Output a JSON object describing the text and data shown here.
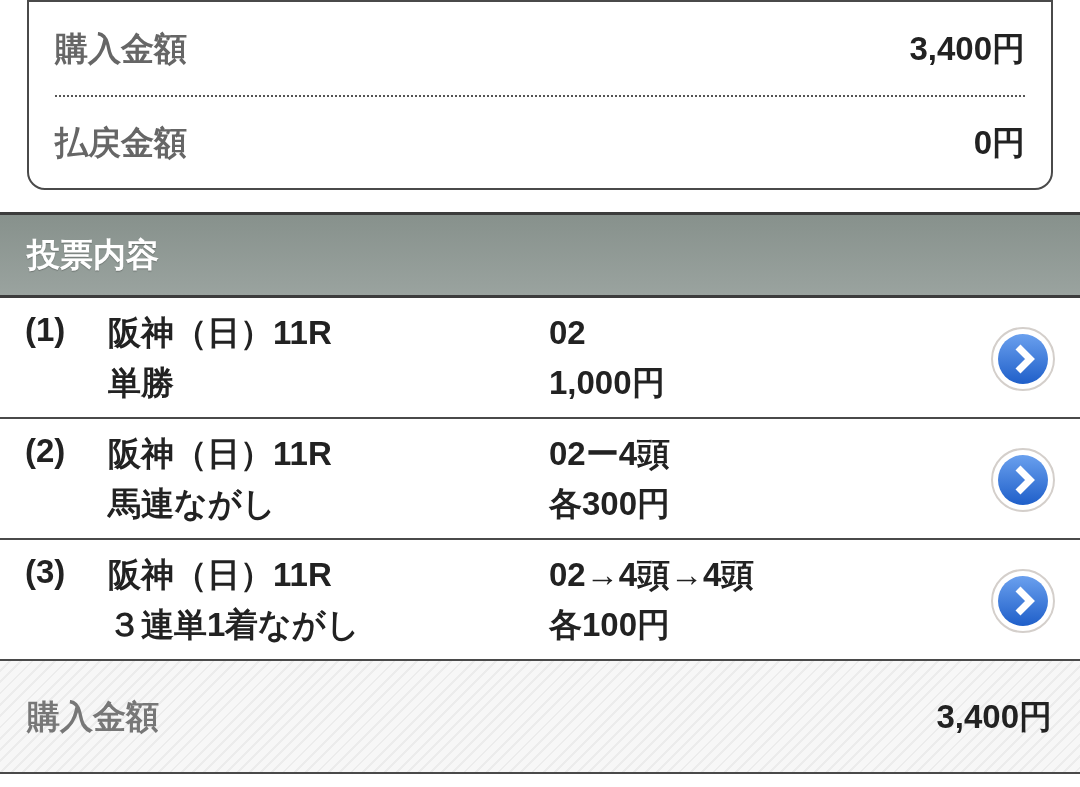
{
  "summary": {
    "rows": [
      {
        "label": "購入金額",
        "value": "3,400円"
      },
      {
        "label": "払戻金額",
        "value": "0円"
      }
    ]
  },
  "section": {
    "title": "投票内容"
  },
  "bets": [
    {
      "number": "(1)",
      "race": "阪神（日）11R",
      "type": "単勝",
      "selection": "02",
      "amount": "1,000円"
    },
    {
      "number": "(2)",
      "race": "阪神（日）11R",
      "type": "馬連ながし",
      "selection": "02ー4頭",
      "amount": "各300円"
    },
    {
      "number": "(3)",
      "race": "阪神（日）11R",
      "type": "３連単1着ながし",
      "selection": "02→4頭→4頭",
      "amount": "各100円"
    }
  ],
  "total": {
    "label": "購入金額",
    "value": "3,400円"
  }
}
